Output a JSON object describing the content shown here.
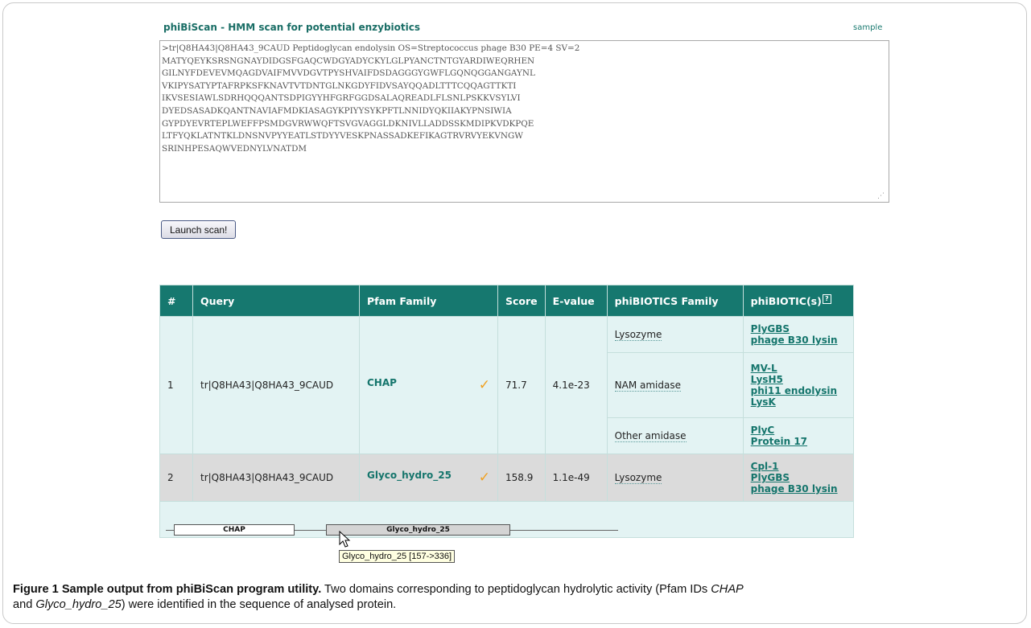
{
  "app": {
    "title": "phiBiScan - HMM scan for potential enzybiotics",
    "sample_link": "sample"
  },
  "sequence_input": {
    "value": ">tr|Q8HA43|Q8HA43_9CAUD Peptidoglycan endolysin OS=Streptococcus phage B30 PE=4 SV=2\nMATYQEYKSRSNGNAYDIDGSFGAQCWDGYADYCKYLGLPYANCTNTGYARDIWEQRHEN\nGILNYFDEVEVMQAGDVAIFMVVDGVTPYSHVAIFDSDAGGGYGWFLGQNQGGANGAYNL\nVKIPYSATYPTAFRPKSFKNAVTVTDNTGLNKGDYFIDVSAYQQADLTTTCQQAGTTKTI\nIKVSESIAWLSDRHQQQANTSDPIGYYHFGRFGGDSALAQREADLFLSNLPSKKVSYLVI\nDYEDSASADKQANTNAVIAFMDKIASAGYKPIYYSYKPFTLNNIDYQKIIAKYPNSIWIA\nGYPDYEVRTEPLWEFFPSMDGVRWWQFTSVGVAGGLDKNIVLLADDSSKMDIPKVDKPQE\nLTFYQKLATNTKLDNSNVPYYEATLSTDYYVESKPNASSADKEFIKAGTRVRVYEKVNGW\nSRINHPESAQWVEDNYLVNATDM"
  },
  "launch_button": "Launch scan!",
  "table": {
    "headers": [
      "#",
      "Query",
      "Pfam Family",
      "Score",
      "E-value",
      "phiBIOTICS Family",
      "phiBIOTIC(s)"
    ],
    "help_icon_glyph": "?",
    "rows": [
      {
        "num": "1",
        "query": "tr|Q8HA43|Q8HA43_9CAUD",
        "pfam": "CHAP",
        "check": "✓",
        "score": "71.7",
        "evalue": "4.1e-23",
        "families": [
          {
            "name": "Lysozyme",
            "biotics": [
              "PlyGBS",
              "phage B30 lysin"
            ]
          },
          {
            "name": "NAM amidase",
            "biotics": [
              "MV-L",
              "LysH5",
              "phi11 endolysin",
              "LysK"
            ]
          },
          {
            "name": "Other amidase",
            "biotics": [
              "PlyC",
              "Protein 17"
            ]
          }
        ]
      },
      {
        "num": "2",
        "query": "tr|Q8HA43|Q8HA43_9CAUD",
        "pfam": "Glyco_hydro_25",
        "check": "✓",
        "score": "158.9",
        "evalue": "1.1e-49",
        "families": [
          {
            "name": "Lysozyme",
            "biotics": [
              "Cpl-1",
              "PlyGBS",
              "phage B30 lysin"
            ]
          }
        ]
      }
    ]
  },
  "domain_map": {
    "domains": [
      "CHAP",
      "Glyco_hydro_25"
    ],
    "tooltip": "Glyco_hydro_25 [157->336]"
  },
  "caption": {
    "label": "Figure 1 Sample output from phiBiScan program utility.",
    "text_1": " Two domains corresponding to peptidoglycan hydrolytic activity (Pfam IDs ",
    "id_1": "CHAP",
    "text_2": "and ",
    "id_2": "Glyco_hydro_25",
    "text_3": ") were identified in the sequence of analysed protein."
  },
  "colors": {
    "header_bg": "#16786f",
    "cell_bg": "#e3f3f3",
    "row2_bg": "#dbdbdb",
    "link": "#15756c",
    "check": "#f0a020"
  }
}
